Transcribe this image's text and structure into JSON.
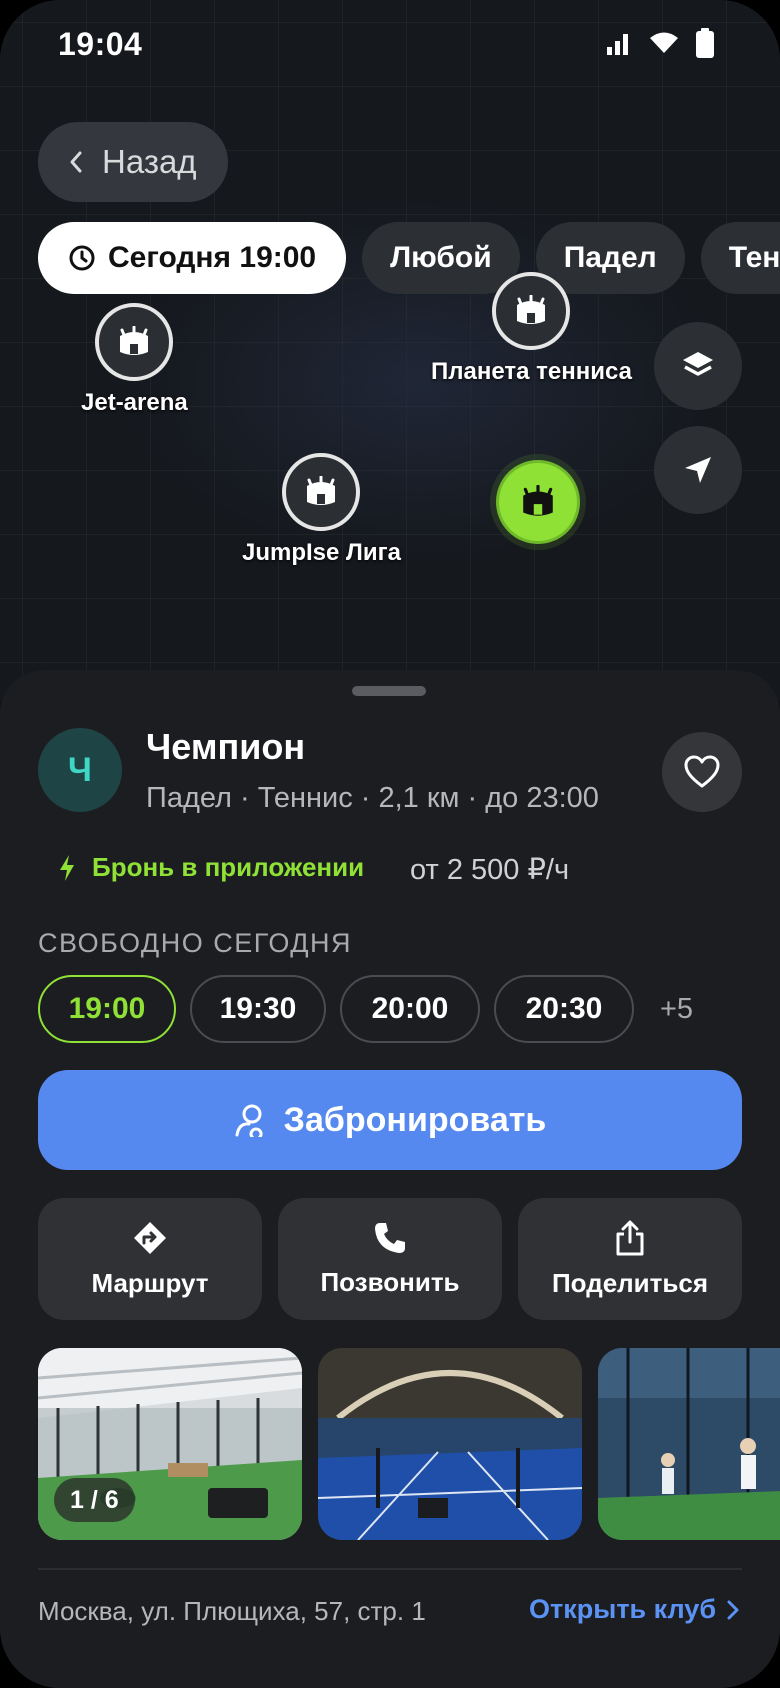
{
  "status_bar": {
    "time": "19:04"
  },
  "header": {
    "back_label": "Назад"
  },
  "filters": [
    {
      "label": "Сегодня 19:00",
      "active": true,
      "icon": "clock-icon"
    },
    {
      "label": "Любой",
      "active": false
    },
    {
      "label": "Падел",
      "active": false
    },
    {
      "label": "Теннис",
      "active": false
    }
  ],
  "map": {
    "pins": [
      {
        "label": "Jet-arena"
      },
      {
        "label": "Планета тенниса"
      },
      {
        "label": "JumpIse Лига"
      },
      {
        "label": "",
        "selected": true
      }
    ],
    "accent": "#8fe136"
  },
  "club": {
    "initial": "Ч",
    "name": "Чемпион",
    "meta": "Падел · Теннис · 2,1 км · до 23:00",
    "booking_badge": "Бронь в приложении",
    "price": "от 2 500 ₽/ч",
    "slots_title": "СВОБОДНО СЕГОДНЯ",
    "slots": [
      "19:00",
      "19:30",
      "20:00",
      "20:30"
    ],
    "slots_more": "+5",
    "book_label": "Забронировать",
    "actions": {
      "route": "Маршрут",
      "call": "Позвонить",
      "share": "Поделиться"
    },
    "photo_counter": "1 / 6",
    "address": "Москва, ул. Плющиха, 57, стр. 1",
    "open_club": "Открыть клуб"
  },
  "colors": {
    "primary": "#5689ef",
    "accent_green": "#8fe136",
    "sheet_bg": "#1c1d20"
  }
}
